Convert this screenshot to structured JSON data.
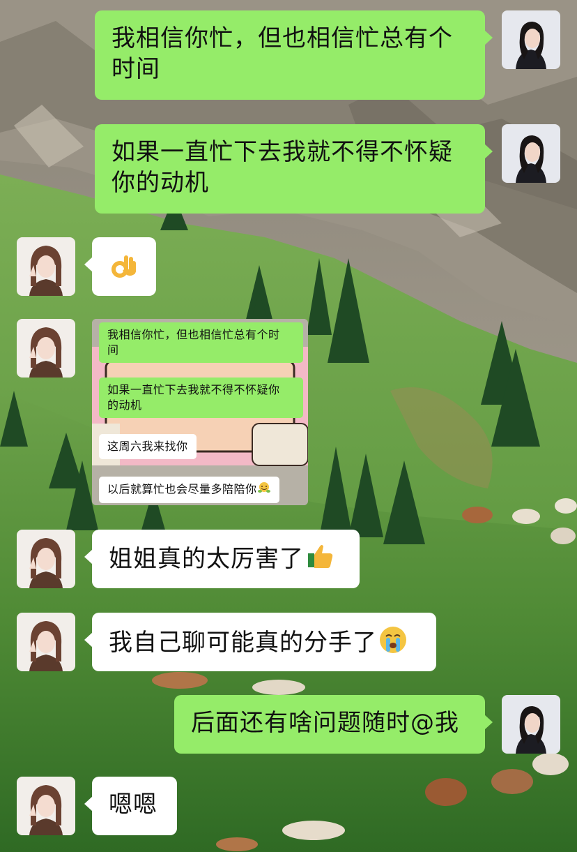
{
  "messages": [
    {
      "from": "me",
      "text": "我相信你忙，但也相信忙总有个时间",
      "line1": "我相信你忙，但也相信忙总有个",
      "line2": "时间"
    },
    {
      "from": "me",
      "text": "如果一直忙下去我就不得不怀疑你的动机",
      "line1": "如果一直忙下去我就不得不怀疑",
      "line2": "你的动机"
    },
    {
      "from": "other",
      "emoji": "ok-hand-emoji"
    },
    {
      "from": "other",
      "type": "screenshot"
    },
    {
      "from": "other",
      "text": "姐姐真的太厉害了",
      "emoji": "thumbs-up-emoji"
    },
    {
      "from": "other",
      "text": "我自己聊可能真的分手了",
      "emoji": "crying-face-emoji"
    },
    {
      "from": "me",
      "text": "后面还有啥问题随时@我"
    },
    {
      "from": "other",
      "text": "嗯嗯"
    }
  ],
  "screenshot": {
    "msg1_line1": "我相信你忙，但也相信忙总有个时",
    "msg1_line2": "间",
    "msg2_line1": "如果一直忙下去我就不得不怀疑你",
    "msg2_line2": "的动机",
    "msg3": "这周六我来找你",
    "msg4": "以后就算忙也会尽量多陪陪你"
  },
  "colors": {
    "my_bubble": "#95ec69",
    "other_bubble": "#ffffff"
  }
}
